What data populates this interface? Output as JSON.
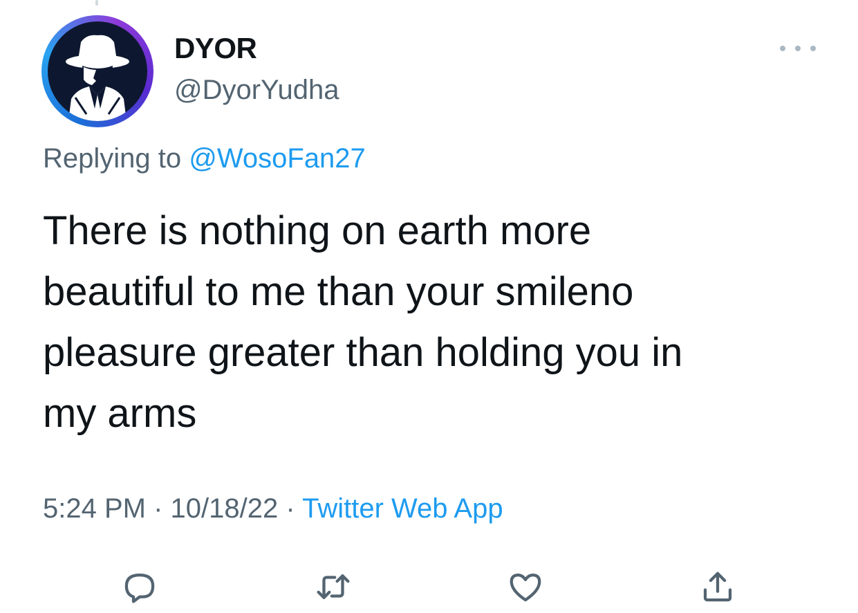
{
  "author": {
    "display_name": "DYOR",
    "handle": "@DyorYudha",
    "avatar_icon": "hat-silhouette-avatar"
  },
  "reply": {
    "prefix": "Replying to",
    "mention": "@WosoFan27"
  },
  "tweet": {
    "text": "There is nothing on earth more\nbeautiful to me than your smileno\npleasure greater than holding you in\nmy arms"
  },
  "meta": {
    "time": "5:24 PM",
    "separator": "·",
    "date": "10/18/22",
    "source": "Twitter Web App"
  },
  "actions": [
    {
      "name": "reply",
      "icon": "reply-icon"
    },
    {
      "name": "retweet",
      "icon": "retweet-icon"
    },
    {
      "name": "like",
      "icon": "heart-icon"
    },
    {
      "name": "share",
      "icon": "share-icon"
    }
  ],
  "colors": {
    "accent": "#1d9bf0",
    "secondary_text": "#536471",
    "primary_text": "#0f1419"
  }
}
